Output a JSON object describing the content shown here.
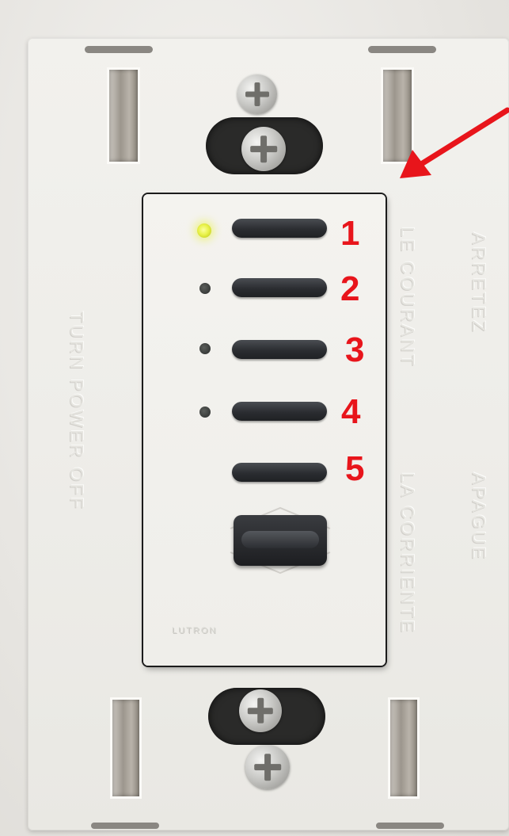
{
  "plate_text": {
    "left": "TURN POWER OFF",
    "right_col1": "ARRETEZ",
    "right_col2": "LE COURANT",
    "right_col3": "APAGUE",
    "right_col4": "LA CORRIENTE"
  },
  "keypad": {
    "brand": "LUTRON",
    "buttons": [
      {
        "label": "1",
        "led": "on"
      },
      {
        "label": "2",
        "led": "off"
      },
      {
        "label": "3",
        "led": "off"
      },
      {
        "label": "4",
        "led": "off"
      },
      {
        "label": "5",
        "led": "none"
      }
    ]
  },
  "colors": {
    "annotation_red": "#e8151b",
    "led_on": "#e9f24a",
    "button": "#2b2d31"
  },
  "icons": [
    "screw-icon",
    "red-arrow-icon"
  ]
}
